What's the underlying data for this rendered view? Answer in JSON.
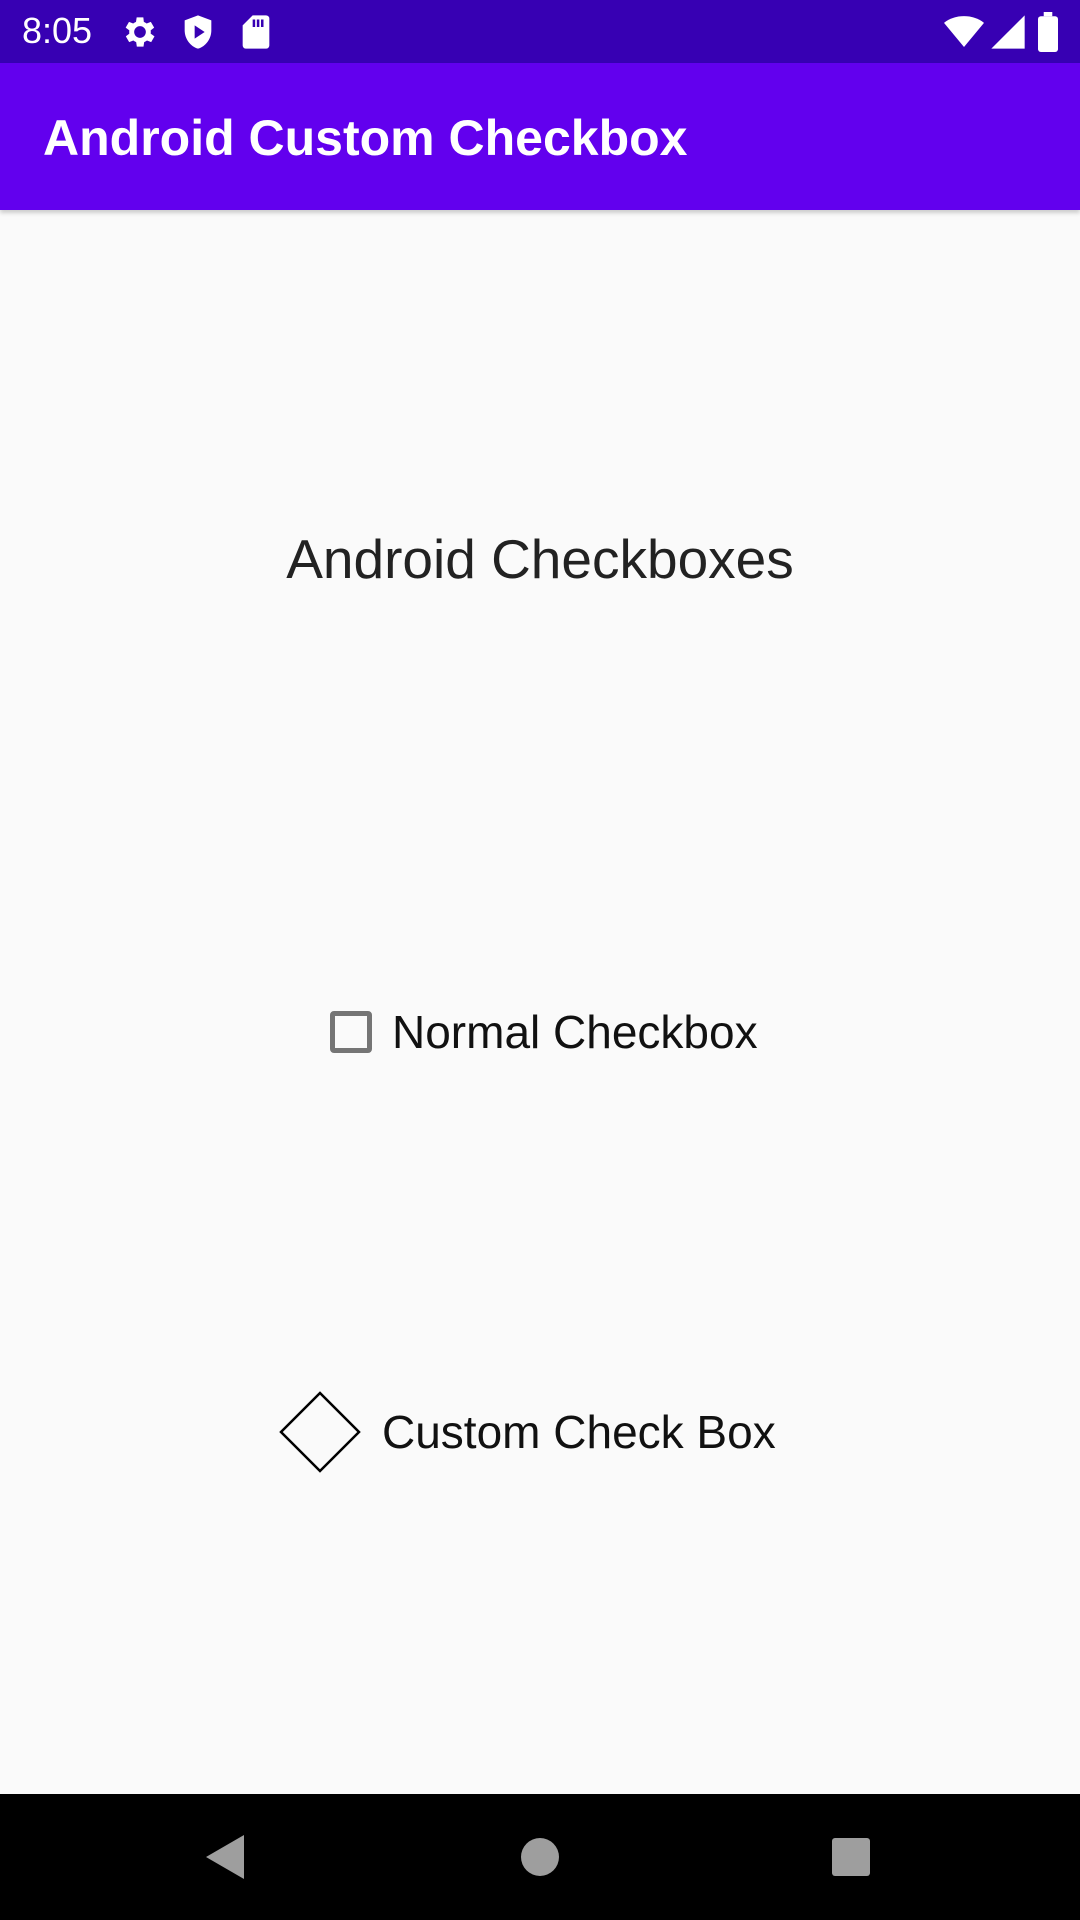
{
  "status_bar": {
    "time": "8:05",
    "background": "#3700b3",
    "icons_left": [
      "settings-gear-icon",
      "shield-play-icon",
      "sd-card-icon"
    ],
    "icons_right": [
      "wifi-icon",
      "cell-signal-icon",
      "battery-icon"
    ]
  },
  "app_bar": {
    "title": "Android Custom Checkbox",
    "background": "#6200ee"
  },
  "main": {
    "heading": "Android Checkboxes",
    "normal_checkbox": {
      "label": "Normal Checkbox",
      "checked": false
    },
    "custom_checkbox": {
      "label": "Custom Check Box",
      "checked": false
    }
  },
  "nav_bar": {
    "buttons": [
      "back-icon",
      "home-icon",
      "recents-icon"
    ]
  }
}
